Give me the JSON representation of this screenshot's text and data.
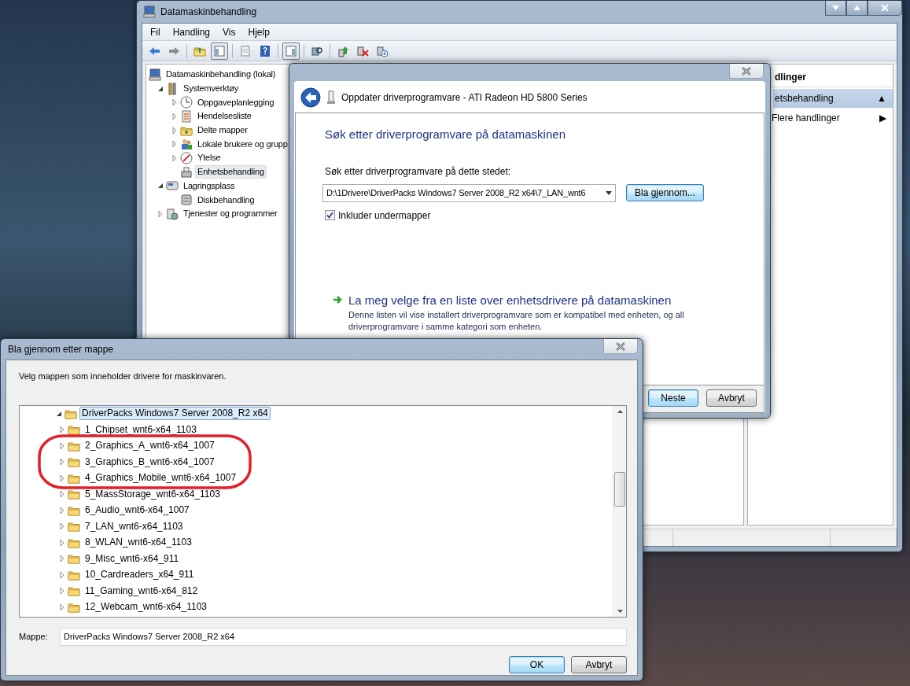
{
  "main_window": {
    "title": "Datamaskinbehandling",
    "menu": [
      "Fil",
      "Handling",
      "Vis",
      "Hjelp"
    ],
    "toolbar": [
      {
        "pressed": false
      },
      {
        "pressed": false
      },
      {
        "pressed": false
      },
      {
        "pressed": true
      },
      {
        "pressed": false
      },
      {
        "pressed": false
      },
      {
        "pressed": true
      },
      {
        "pressed": false
      },
      {
        "pressed": false
      },
      {
        "pressed": false
      },
      {
        "pressed": false
      }
    ],
    "tree": [
      {
        "label": "Datamaskinbehandling (lokal)",
        "selected": false,
        "children": [
          {
            "label": "Systemverktøy",
            "expanded": true,
            "selected": false,
            "children": [
              {
                "label": "Oppgaveplanlegging",
                "expanded": false,
                "selected": false
              },
              {
                "label": "Hendelsesliste",
                "expanded": false,
                "selected": false
              },
              {
                "label": "Delte mapper",
                "expanded": false,
                "selected": false
              },
              {
                "label": "Lokale brukere og grupp",
                "expanded": false,
                "selected": false
              },
              {
                "label": "Ytelse",
                "expanded": false,
                "selected": false
              },
              {
                "label": "Enhetsbehandling",
                "selected": true
              }
            ]
          },
          {
            "label": "Lagringsplass",
            "expanded": true,
            "selected": false,
            "children": [
              {
                "label": "Diskbehandling",
                "selected": false
              }
            ]
          },
          {
            "label": "Tjenester og programmer",
            "expanded": false,
            "selected": false
          }
        ]
      }
    ],
    "actions": {
      "header": "dlinger",
      "section": "etsbehandling",
      "section_glyph": "▲",
      "items": [
        {
          "label": "Flere handlinger",
          "glyph": "▶"
        }
      ]
    }
  },
  "wizard": {
    "title": "Oppdater driverprogramvare - ATI Radeon HD 5800 Series",
    "heading": "Søk etter driverprogramvare på datamaskinen",
    "location_label": "Søk etter driverprogramvare på dette stedet:",
    "location_value": "D:\\1Drivere\\DriverPacks Windows7 Server 2008_R2 x64\\7_LAN_wnt6",
    "browse_button": "Bla gjennom...",
    "include_subfolders": {
      "label": "Inkluder undermapper",
      "checked": true
    },
    "pick_link": {
      "title": "La meg velge fra en liste over enhetsdrivere på datamaskinen",
      "description": "Denne listen vil vise installert driverprogramvare som er kompatibel med enheten, og all driverprogramvare i samme kategori som enheten."
    },
    "buttons": [
      {
        "label": "Neste",
        "default": true
      },
      {
        "label": "Avbryt",
        "default": false
      }
    ]
  },
  "browse_dialog": {
    "title": "Bla gjennom etter mappe",
    "instruction": "Velg mappen som inneholder drivere for maskinvaren.",
    "tree": [
      {
        "label": "DriverPacks Windows7 Server 2008_R2 x64",
        "expanded": true,
        "selected": true,
        "children": [
          {
            "label": "1_Chipset_wnt6-x64_1103",
            "expanded": false,
            "selected": false
          },
          {
            "label": "2_Graphics_A_wnt6-x64_1007",
            "expanded": false,
            "selected": false
          },
          {
            "label": "3_Graphics_B_wnt6-x64_1007",
            "expanded": false,
            "selected": false
          },
          {
            "label": "4_Graphics_Mobile_wnt6-x64_1007",
            "expanded": false,
            "selected": false
          },
          {
            "label": "5_MassStorage_wnt6-x64_1103",
            "expanded": false,
            "selected": false
          },
          {
            "label": "6_Audio_wnt6-x64_1007",
            "expanded": false,
            "selected": false
          },
          {
            "label": "7_LAN_wnt6-x64_1103",
            "expanded": false,
            "selected": false
          },
          {
            "label": "8_WLAN_wnt6-x64_1103",
            "expanded": false,
            "selected": false
          },
          {
            "label": "9_Misc_wnt6-x64_911",
            "expanded": false,
            "selected": false
          },
          {
            "label": "10_Cardreaders_x64_911",
            "expanded": false,
            "selected": false
          },
          {
            "label": "11_Gaming_wnt6-x64_812",
            "expanded": false,
            "selected": false
          },
          {
            "label": "12_Webcam_wnt6-x64_1103",
            "expanded": false,
            "selected": false
          }
        ]
      }
    ],
    "folder_label": "Mappe:",
    "folder_value": "DriverPacks Windows7 Server 2008_R2 x64",
    "buttons": [
      {
        "label": "OK",
        "default": true
      },
      {
        "label": "Avbryt",
        "default": false
      }
    ]
  }
}
